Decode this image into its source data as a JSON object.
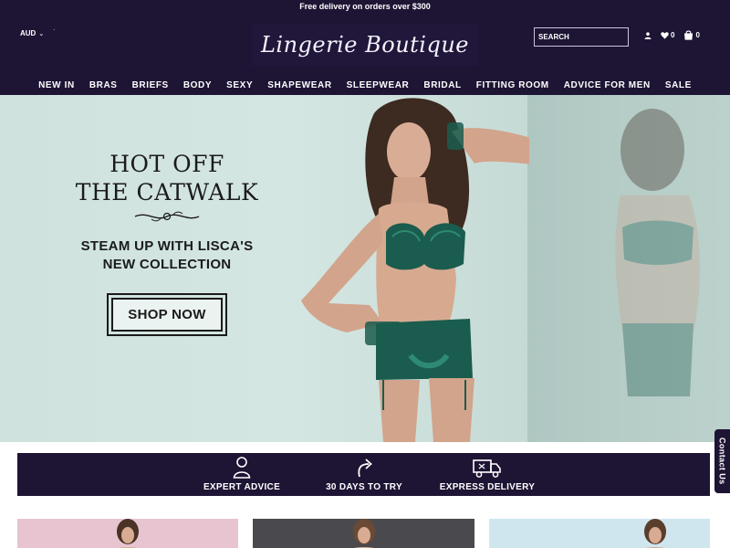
{
  "promo": {
    "text": "Free delivery on orders over $300"
  },
  "header": {
    "currency": "AUD",
    "logo": "Lingerie Boutique",
    "search_placeholder": "SEARCH",
    "wishlist_count": "0",
    "cart_count": "0"
  },
  "nav": {
    "items": [
      "NEW IN",
      "BRAS",
      "BRIEFS",
      "BODY",
      "SEXY",
      "SHAPEWEAR",
      "SLEEPWEAR",
      "BRIDAL",
      "FITTING ROOM",
      "ADVICE FOR MEN",
      "SALE"
    ]
  },
  "hero": {
    "title_line1": "HOT OFF",
    "title_line2": "THE CATWALK",
    "subtitle_line1": "STEAM UP WITH LISCA'S",
    "subtitle_line2": "NEW COLLECTION",
    "cta": "SHOP NOW"
  },
  "features": {
    "items": [
      {
        "label": "EXPERT ADVICE",
        "icon": "person-icon"
      },
      {
        "label": "30 DAYS TO TRY",
        "icon": "return-arrow-icon"
      },
      {
        "label": "EXPRESS DELIVERY",
        "icon": "truck-icon"
      }
    ]
  },
  "contact_tab": {
    "label": "Contact Us"
  },
  "colors": {
    "header_bg": "#1e1434",
    "hero_bg": "#d4e6e2",
    "text_dark": "#1b1b1b",
    "lingerie_green": "#1a5c4e"
  }
}
